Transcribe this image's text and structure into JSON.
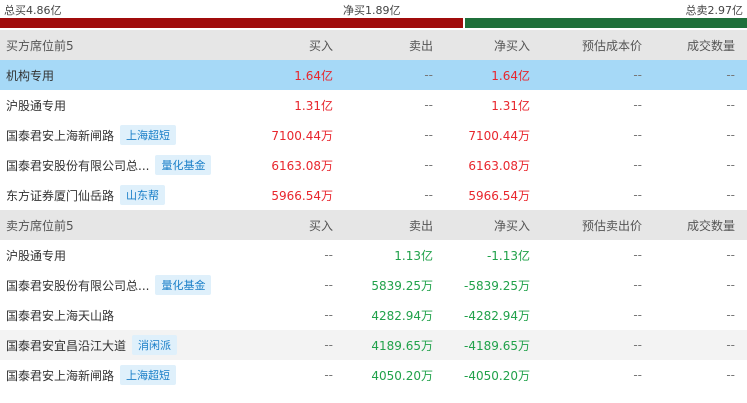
{
  "summary": {
    "buy_label": "总买4.86亿",
    "net_label": "净买1.89亿",
    "sell_label": "总卖2.97亿",
    "buy_share": 0.62,
    "colors": {
      "buy": "#a00c0c",
      "sell": "#1f6f3a"
    }
  },
  "buy_section": {
    "headers": [
      "买方席位前5",
      "买入",
      "卖出",
      "净买入",
      "预估成本价",
      "成交数量"
    ],
    "rows": [
      {
        "name": "机构专用",
        "tag": "",
        "buy": "1.64亿",
        "sell": "--",
        "net": "1.64亿",
        "cost": "--",
        "volume": "--"
      },
      {
        "name": "沪股通专用",
        "tag": "",
        "buy": "1.31亿",
        "sell": "--",
        "net": "1.31亿",
        "cost": "--",
        "volume": "--"
      },
      {
        "name": "国泰君安上海新闸路",
        "tag": "上海超短",
        "buy": "7100.44万",
        "sell": "--",
        "net": "7100.44万",
        "cost": "--",
        "volume": "--"
      },
      {
        "name": "国泰君安股份有限公司总...",
        "tag": "量化基金",
        "buy": "6163.08万",
        "sell": "--",
        "net": "6163.08万",
        "cost": "--",
        "volume": "--"
      },
      {
        "name": "东方证券厦门仙岳路",
        "tag": "山东帮",
        "buy": "5966.54万",
        "sell": "--",
        "net": "5966.54万",
        "cost": "--",
        "volume": "--"
      }
    ]
  },
  "sell_section": {
    "headers": [
      "卖方席位前5",
      "买入",
      "卖出",
      "净买入",
      "预估卖出价",
      "成交数量"
    ],
    "rows": [
      {
        "name": "沪股通专用",
        "tag": "",
        "buy": "--",
        "sell": "1.13亿",
        "net": "-1.13亿",
        "cost": "--",
        "volume": "--"
      },
      {
        "name": "国泰君安股份有限公司总...",
        "tag": "量化基金",
        "buy": "--",
        "sell": "5839.25万",
        "net": "-5839.25万",
        "cost": "--",
        "volume": "--"
      },
      {
        "name": "国泰君安上海天山路",
        "tag": "",
        "buy": "--",
        "sell": "4282.94万",
        "net": "-4282.94万",
        "cost": "--",
        "volume": "--"
      },
      {
        "name": "国泰君安宜昌沿江大道",
        "tag": "消闲派",
        "buy": "--",
        "sell": "4189.65万",
        "net": "-4189.65万",
        "cost": "--",
        "volume": "--"
      },
      {
        "name": "国泰君安上海新闸路",
        "tag": "上海超短",
        "buy": "--",
        "sell": "4050.20万",
        "net": "-4050.20万",
        "cost": "--",
        "volume": "--"
      }
    ]
  }
}
